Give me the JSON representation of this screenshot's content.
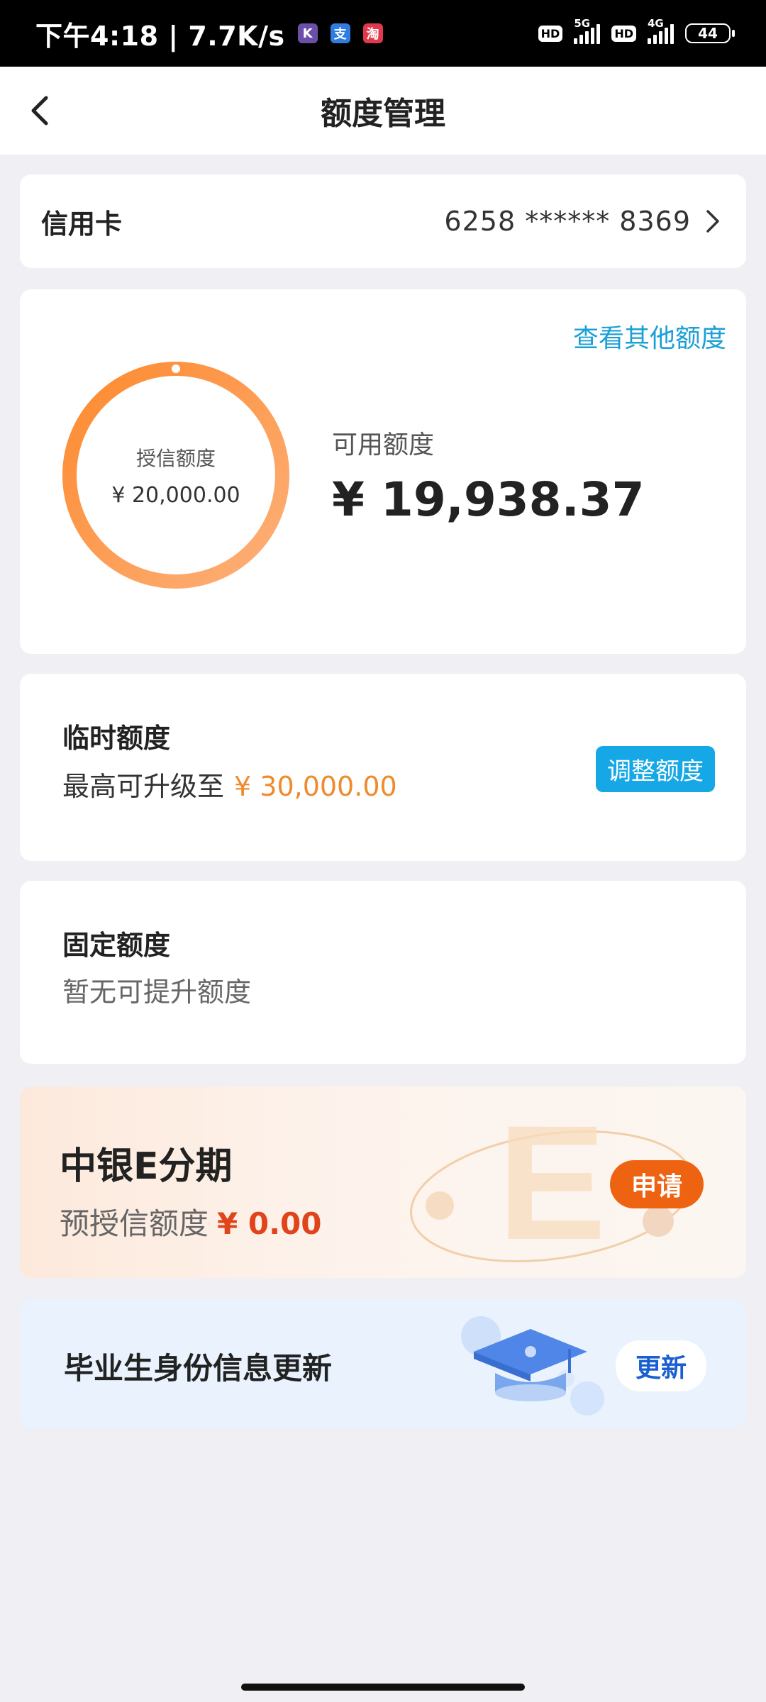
{
  "status_bar": {
    "time": "下午4:18 | 7.7K/s",
    "apps": [
      {
        "name": "k-app-icon",
        "glyph": "K",
        "color": "#6a4ea8"
      },
      {
        "name": "alipay-icon",
        "glyph": "支",
        "color": "#2f7de1"
      },
      {
        "name": "taobao-icon",
        "glyph": "淘",
        "color": "#e2384d"
      }
    ],
    "hd1": "HD",
    "net1": "5G",
    "hd2": "HD",
    "net2": "4G",
    "battery": "44"
  },
  "header": {
    "title": "额度管理"
  },
  "card_account": {
    "label": "信用卡",
    "card_number": "6258 ****** 8369"
  },
  "limit_summary": {
    "other_link": "查看其他额度",
    "credit_label": "授信额度",
    "credit_value": "¥ 20,000.00",
    "available_label": "可用额度",
    "available_value": "¥ 19,938.37",
    "colors": {
      "ring_start": "#fd8a2e",
      "ring_end": "#fdb07a"
    }
  },
  "temporary_limit": {
    "title": "临时额度",
    "prefix": "最高可升级至",
    "amount": "¥ 30,000.00",
    "button": "调整额度"
  },
  "fixed_limit": {
    "title": "固定额度",
    "subtitle": "暂无可提升额度"
  },
  "installment": {
    "title": "中银E分期",
    "prefix": "预授信额度",
    "amount": "¥ 0.00",
    "button": "申请"
  },
  "graduate": {
    "title": "毕业生身份信息更新",
    "button": "更新"
  }
}
